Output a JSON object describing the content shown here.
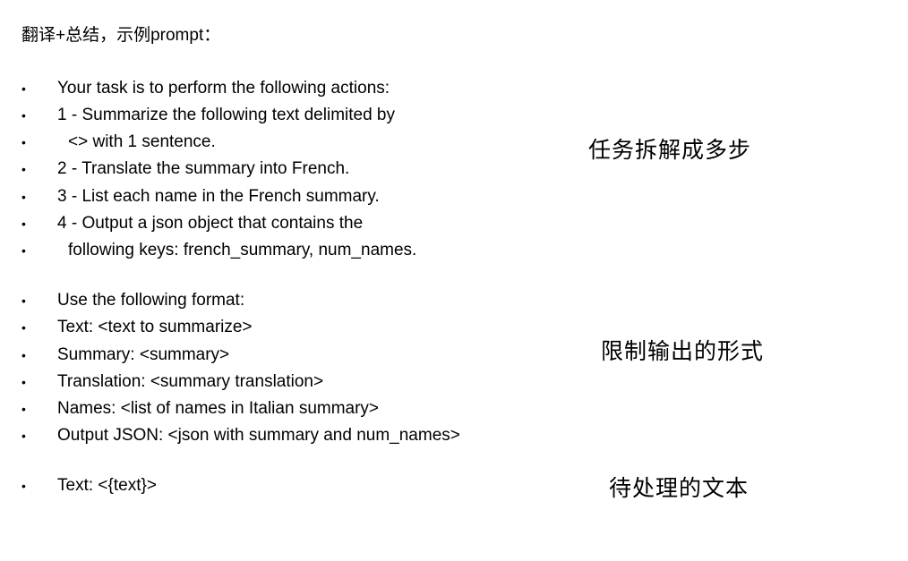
{
  "header": {
    "title": "翻译+总结，示例prompt："
  },
  "bullet_symbol": "•",
  "steps": [
    "Your task is to perform the following actions:",
    "1 - Summarize the following text delimited by",
    "<> with 1 sentence.",
    "2 - Translate the summary into French.",
    "3 - List each name in the French summary.",
    "4 - Output a json object that contains the",
    "following keys: french_summary, num_names."
  ],
  "format": [
    "Use the following format:",
    "Text: <text to summarize>",
    "Summary: <summary>",
    "Translation: <summary translation>",
    "Names: <list of names in Italian summary>",
    "Output JSON: <json with summary and num_names>"
  ],
  "input": [
    "Text: <{text}>"
  ],
  "annotations": {
    "steps_note": "任务拆解成多步",
    "format_note": "限制输出的形式",
    "input_note": "待处理的文本"
  }
}
